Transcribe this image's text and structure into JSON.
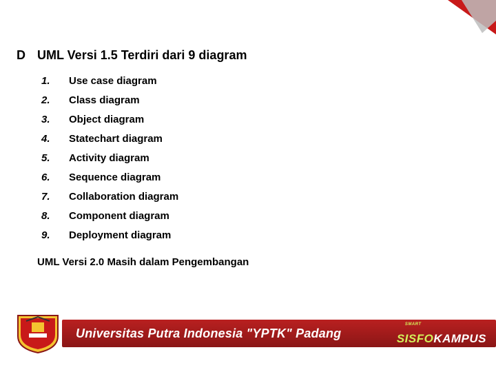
{
  "corner": {
    "color_red": "#C81919",
    "color_gray": "#BDBDBD"
  },
  "heading": {
    "letter": "D",
    "text": "UML Versi 1.5 Terdiri dari 9 diagram"
  },
  "list": [
    {
      "num": "1.",
      "label": "Use case diagram"
    },
    {
      "num": "2.",
      "label": "Class diagram"
    },
    {
      "num": "3.",
      "label": "Object diagram"
    },
    {
      "num": "4.",
      "label": "Statechart diagram"
    },
    {
      "num": "5.",
      "label": "Activity diagram"
    },
    {
      "num": "6.",
      "label": "Sequence diagram"
    },
    {
      "num": "7.",
      "label": "Collaboration diagram"
    },
    {
      "num": "8.",
      "label": "Component diagram"
    },
    {
      "num": "9.",
      "label": "Deployment diagram"
    }
  ],
  "subtext": "UML Versi 2.0 Masih dalam Pengembangan",
  "footer": {
    "university": "Universitas Putra Indonesia \"YPTK\" Padang",
    "sisfokampus_smart": "SMART",
    "sisfokampus_part1": "SISFO",
    "sisfokampus_part2": "KAMPUS"
  }
}
